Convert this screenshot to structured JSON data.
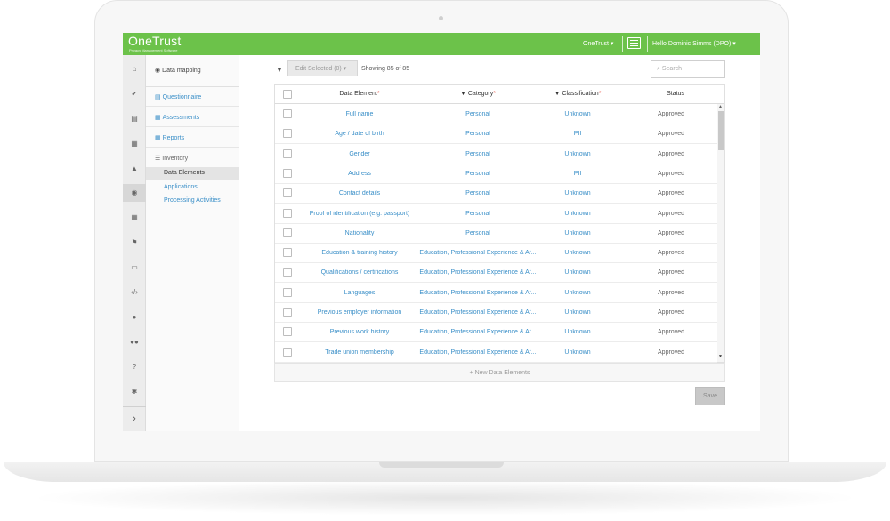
{
  "header": {
    "brand": "OneTrust",
    "brand_subtitle": "Privacy Management Software",
    "nav_menu": "OneTrust ▾",
    "user_menu": "Hello Dominic Simms (DPO) ▾",
    "bar_color": "#6cc24a"
  },
  "rail": {
    "icons": [
      "home-icon",
      "check-icon",
      "document-icon",
      "grid-icon",
      "building-icon",
      "globe-icon",
      "table-icon",
      "flag-icon",
      "folder-icon",
      "code-icon",
      "user-icon",
      "users-icon",
      "help-icon",
      "gear-icon"
    ],
    "expand": "›"
  },
  "menu": {
    "head": "Data mapping",
    "questionnaire": "Questionnaire",
    "assessments": "Assessments",
    "reports": "Reports",
    "inventory": "Inventory",
    "data_elements": "Data Elements",
    "applications": "Applications",
    "processing_activities": "Processing Activities"
  },
  "toolbar": {
    "edit_label": "Edit  Selected (0) ▾",
    "showing": "Showing 85 of 85",
    "search_placeholder": "Search"
  },
  "table": {
    "headers": {
      "data_element": "Data Element",
      "category": "Category",
      "classification": "Classification",
      "status": "Status"
    },
    "rows": [
      {
        "element": "Full name",
        "category": "Personal",
        "classification": "Unknown",
        "status": "Approved"
      },
      {
        "element": "Age / date of birth",
        "category": "Personal",
        "classification": "PII",
        "status": "Approved"
      },
      {
        "element": "Gender",
        "category": "Personal",
        "classification": "Unknown",
        "status": "Approved"
      },
      {
        "element": "Address",
        "category": "Personal",
        "classification": "PII",
        "status": "Approved"
      },
      {
        "element": "Contact details",
        "category": "Personal",
        "classification": "Unknown",
        "status": "Approved"
      },
      {
        "element": "Proof of identification (e.g. passport)",
        "category": "Personal",
        "classification": "Unknown",
        "status": "Approved"
      },
      {
        "element": "Nationality",
        "category": "Personal",
        "classification": "Unknown",
        "status": "Approved"
      },
      {
        "element": "Education & training history",
        "category": "Education, Professional Experience & Af...",
        "classification": "Unknown",
        "status": "Approved"
      },
      {
        "element": "Qualifications / certifications",
        "category": "Education, Professional Experience & Af...",
        "classification": "Unknown",
        "status": "Approved"
      },
      {
        "element": "Languages",
        "category": "Education, Professional Experience & Af...",
        "classification": "Unknown",
        "status": "Approved"
      },
      {
        "element": "Previous employer information",
        "category": "Education, Professional Experience & Af...",
        "classification": "Unknown",
        "status": "Approved"
      },
      {
        "element": "Previous work history",
        "category": "Education, Professional Experience & Af...",
        "classification": "Unknown",
        "status": "Approved"
      },
      {
        "element": "Trade union membership",
        "category": "Education, Professional Experience & Af...",
        "classification": "Unknown",
        "status": "Approved"
      }
    ],
    "new_row": "+ New Data Elements"
  },
  "footer": {
    "save": "Save"
  }
}
